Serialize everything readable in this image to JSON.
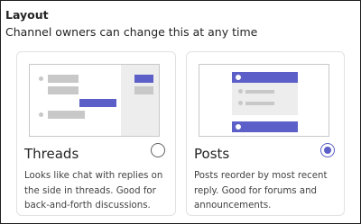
{
  "layout": {
    "title": "Layout",
    "subtitle": "Channel owners can change this at any time"
  },
  "options": {
    "threads": {
      "label": "Threads",
      "description": "Looks like chat with replies on the side in threads. Good for back-and-forth discussions.",
      "selected": false
    },
    "posts": {
      "label": "Posts",
      "description": "Posts reorder by most recent reply. Good for forums and announcements.",
      "selected": true
    }
  },
  "colors": {
    "accent": "#5b5fc7",
    "illustration_gray": "#c8c8c8",
    "border": "#e1e1e1"
  }
}
